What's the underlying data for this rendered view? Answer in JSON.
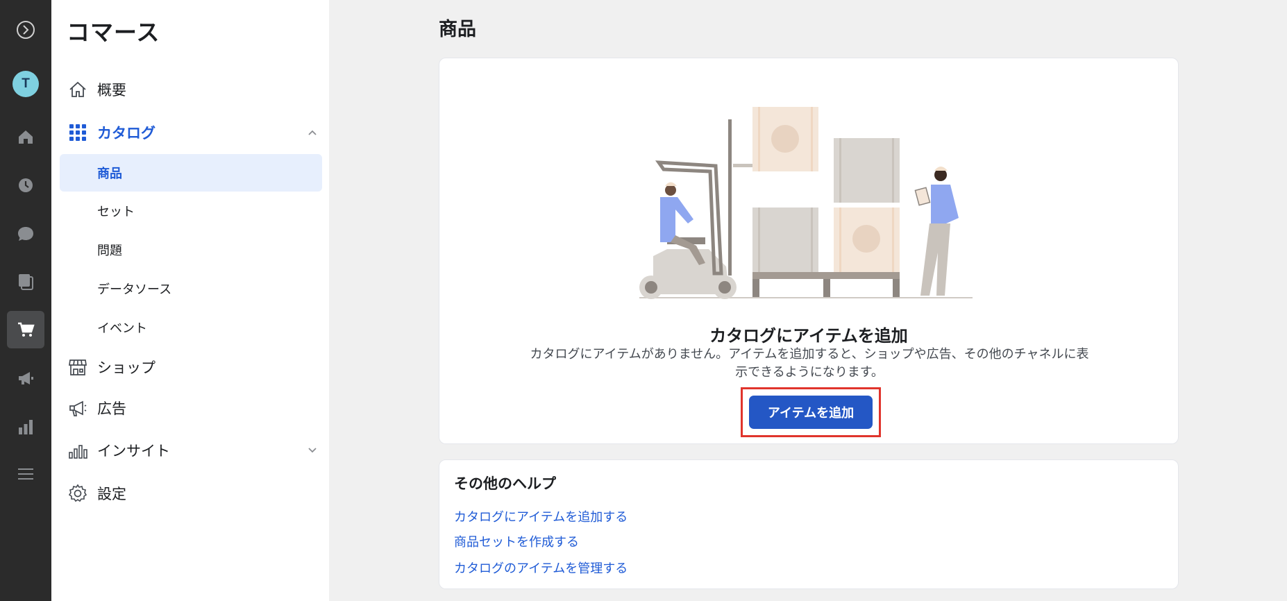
{
  "app": {
    "title": "コマース"
  },
  "rail": {
    "items": [
      {
        "icon": "meta-logo-icon"
      },
      {
        "icon": "avatar",
        "initial": "T"
      },
      {
        "icon": "home-icon"
      },
      {
        "icon": "history-icon"
      },
      {
        "icon": "chat-icon"
      },
      {
        "icon": "pages-icon"
      },
      {
        "icon": "cart-icon",
        "active": true
      },
      {
        "icon": "megaphone-icon"
      },
      {
        "icon": "bar-chart-icon"
      },
      {
        "icon": "menu-icon"
      }
    ]
  },
  "sidebar": {
    "items": [
      {
        "label": "概要",
        "icon": "home-outline-icon"
      },
      {
        "label": "カタログ",
        "icon": "grid-icon",
        "expanded": true
      },
      {
        "label": "ショップ",
        "icon": "store-icon"
      },
      {
        "label": "広告",
        "icon": "megaphone-outline-icon"
      },
      {
        "label": "インサイト",
        "icon": "insights-icon",
        "collapsed": true
      },
      {
        "label": "設定",
        "icon": "gear-icon"
      }
    ],
    "catalog_sub": [
      {
        "label": "商品",
        "active": true
      },
      {
        "label": "セット"
      },
      {
        "label": "問題"
      },
      {
        "label": "データソース"
      },
      {
        "label": "イベント"
      }
    ]
  },
  "main": {
    "page_title": "商品",
    "empty": {
      "title": "カタログにアイテムを追加",
      "description": "カタログにアイテムがありません。アイテムを追加すると、ショップや広告、その他のチャネルに表示できるようになります。",
      "button": "アイテムを追加"
    },
    "help": {
      "title": "その他のヘルプ",
      "links": [
        "カタログにアイテムを追加する",
        "商品セットを作成する",
        "カタログのアイテムを管理する"
      ]
    }
  },
  "colors": {
    "accent": "#1f5bd6",
    "button": "#2457c5",
    "highlight": "#e0342c",
    "rail": "#2b2b2b"
  }
}
